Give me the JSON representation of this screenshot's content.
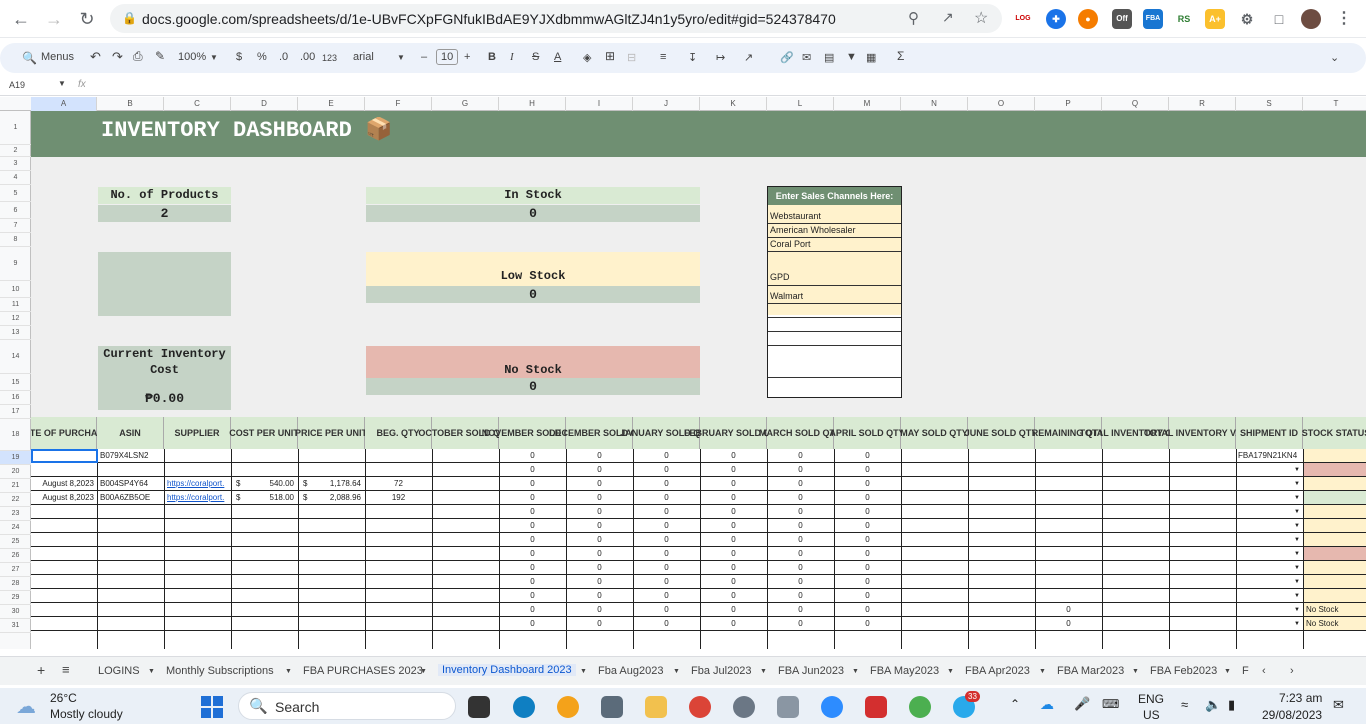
{
  "browser": {
    "url": "docs.google.com/spreadsheets/d/1e-UBvFCXpFGNfukIBdAE9YJXdbmmwAGltZJ4n1y5yro/edit#gid=524378470",
    "ext_badge_off": "Off",
    "ext_fba": "FBA",
    "ext_rs": "RS",
    "ext_ae": "A+"
  },
  "toolbar": {
    "menus": "Menus",
    "zoom": "100%",
    "currency": "$",
    "percent": "%",
    "dec_less": ".0",
    "dec_more": ".00",
    "num_format": "123",
    "font": "arial",
    "font_size": "10"
  },
  "formula_bar": {
    "cell_ref": "A19",
    "fx": "fx"
  },
  "columns": [
    "A",
    "B",
    "C",
    "D",
    "E",
    "F",
    "G",
    "H",
    "I",
    "J",
    "K",
    "L",
    "M",
    "N",
    "O",
    "P",
    "Q",
    "R",
    "S",
    "T"
  ],
  "rows": [
    "1",
    "2",
    "3",
    "4",
    "5",
    "6",
    "7",
    "8",
    "9",
    "10",
    "11",
    "12",
    "13",
    "14",
    "15",
    "16",
    "17",
    "18",
    "19",
    "20",
    "21",
    "22",
    "23",
    "24",
    "25",
    "26",
    "27",
    "28",
    "29",
    "30",
    "31"
  ],
  "dashboard": {
    "title": "INVENTORY DASHBOARD 📦",
    "num_products_label": "No. of Products",
    "num_products_value": "2",
    "in_stock_label": "In Stock",
    "in_stock_value": "0",
    "low_stock_label": "Low Stock",
    "low_stock_value": "0",
    "no_stock_label": "No Stock",
    "no_stock_value": "0",
    "inventory_cost_label_1": "Current Inventory",
    "inventory_cost_label_2": "Cost",
    "inventory_cost_value": "₱0.00",
    "channels_header": "Enter Sales Channels Here:",
    "channels": [
      "Webstaurant",
      "American Wholesaler",
      "Coral Port",
      "GPD",
      "Walmart"
    ]
  },
  "table": {
    "headers": [
      "DATE OF PURCHASE",
      "ASIN",
      "SUPPLIER",
      "COST PER UNIT",
      "PRICE PER UNIT",
      "BEG. QTY",
      "OCTOBER SOLD QTY",
      "NOVEMBER SOLD QTY",
      "DECEMBER SOLD QTY",
      "JANUARY SOLD QTY",
      "FEBRUARY SOLD QTY",
      "MARCH SOLD QTY",
      "APRIL SOLD QTY",
      "MAY SOLD QTY",
      "JUNE SOLD QTY",
      "REMAINING QTY",
      "TOTAL INVENTORY COST",
      "TOTAL INVENTORY VALUE",
      "SHIPMENT ID",
      "STOCK STATUS"
    ],
    "row19_asin": "B079X4LSN2",
    "row19_shipment": "FBA179N21KN4",
    "row21": {
      "date": "August 8,2023",
      "asin": "B004SP4Y64",
      "supplier": "https://coralport.",
      "cost_sym": "$",
      "cost": "540.00",
      "price_sym": "$",
      "price": "1,178.64",
      "qty": "72"
    },
    "row22": {
      "date": "August 8,2023",
      "asin": "B00A6ZB5OE",
      "supplier": "https://coralport.",
      "cost_sym": "$",
      "cost": "518.00",
      "price_sym": "$",
      "price": "2,088.96",
      "qty": "192"
    },
    "zero": "0",
    "no_stock": "No Stock"
  },
  "tabs": [
    "LOGINS",
    "Monthly Subscriptions",
    "FBA PURCHASES 2023",
    "Inventory Dashboard 2023",
    "Fba Aug2023",
    "Fba Jul2023",
    "FBA Jun2023",
    "FBA May2023",
    "FBA Apr2023",
    "FBA Mar2023",
    "FBA Feb2023",
    "F"
  ],
  "taskbar": {
    "temp": "26°C",
    "weather": "Mostly cloudy",
    "search": "Search",
    "lang1": "ENG",
    "lang2": "US",
    "time": "7:23 am",
    "date": "29/08/2023",
    "badge": "33"
  },
  "colors": {
    "banner": "#6f8f72",
    "green_light": "#d9ead3",
    "gray_green": "#c5d3c6",
    "yellow": "#fff2cc",
    "pink": "#e6b8af"
  }
}
